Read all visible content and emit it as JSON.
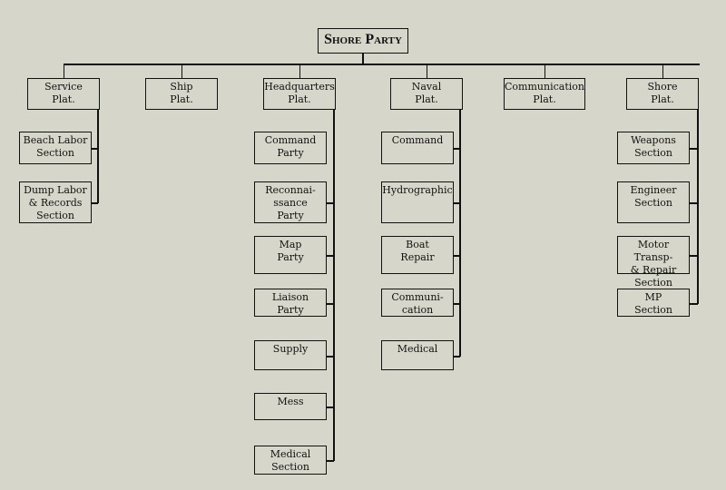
{
  "title": "Shore Party",
  "platoons": [
    {
      "id": "service",
      "label": "Service\nPlat.",
      "sections": [
        {
          "label": "Beach Labor\nSection",
          "connected": true
        },
        {
          "label": "Dump Labor\n& Records\nSection",
          "connected": true
        }
      ]
    },
    {
      "id": "ship",
      "label": "Ship\nPlat.",
      "sections": []
    },
    {
      "id": "headquarters",
      "label": "Headquarters\nPlat.",
      "sections": [
        {
          "label": "Command\nParty",
          "connected": false
        },
        {
          "label": "Reconnai-\nssance\nParty",
          "connected": true
        },
        {
          "label": "Map\nParty",
          "connected": true
        },
        {
          "label": "Liaison\nParty",
          "connected": true
        },
        {
          "label": "Supply",
          "connected": true
        },
        {
          "label": "Mess",
          "connected": true
        },
        {
          "label": "Medical\nSection",
          "connected": true
        }
      ]
    },
    {
      "id": "naval",
      "label": "Naval\nPlat.",
      "sections": [
        {
          "label": "Command",
          "connected": true
        },
        {
          "label": "Hydrographic",
          "connected": true
        },
        {
          "label": "Boat\nRepair",
          "connected": true
        },
        {
          "label": "Communi-\ncation",
          "connected": true
        },
        {
          "label": "Medical",
          "connected": true
        }
      ]
    },
    {
      "id": "communication",
      "label": "Communication\nPlat.",
      "sections": []
    },
    {
      "id": "shore",
      "label": "Shore\nPlat.",
      "sections": [
        {
          "label": "Weapons\nSection",
          "connected": true
        },
        {
          "label": "Engineer\nSection",
          "connected": true
        },
        {
          "label": "Motor Transp-\n& Repair\nSection",
          "connected": true
        },
        {
          "label": "MP\nSection",
          "connected": true
        }
      ]
    }
  ]
}
